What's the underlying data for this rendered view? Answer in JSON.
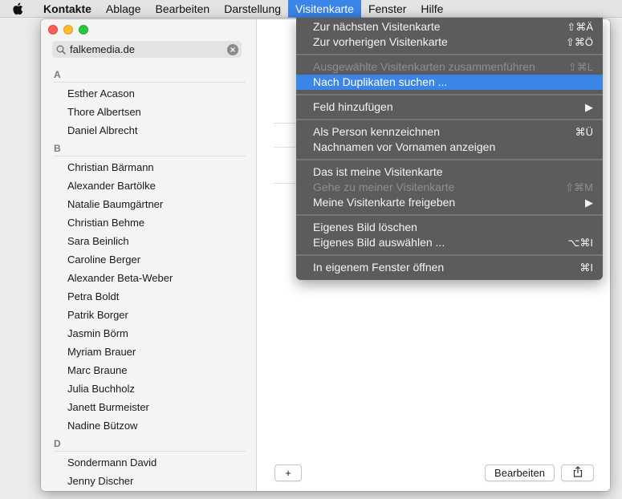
{
  "menubar": {
    "app_name": "Kontakte",
    "items": [
      "Ablage",
      "Bearbeiten",
      "Darstellung",
      "Visitenkarte",
      "Fenster",
      "Hilfe"
    ],
    "active": "Visitenkarte"
  },
  "search": {
    "value": "falkemedia.de"
  },
  "contacts": {
    "sections": [
      {
        "letter": "A",
        "names": [
          "Esther Acason",
          "Thore Albertsen",
          "Daniel Albrecht"
        ]
      },
      {
        "letter": "B",
        "names": [
          "Christian Bärmann",
          "Alexander Bartölke",
          "Natalie Baumgärtner",
          "Christian Behme",
          "Sara Beinlich",
          "Caroline Berger",
          "Alexander Beta-Weber",
          "Petra Boldt",
          "Patrik Borger",
          "Jasmin Börm",
          "Myriam Brauer",
          "Marc Braune",
          "Julia Buchholz",
          "Janett Burmeister",
          "Nadine Bützow"
        ]
      },
      {
        "letter": "D",
        "names": [
          "Sondermann David",
          "Jenny Discher"
        ]
      }
    ]
  },
  "detail": {
    "add_label": "+",
    "edit_label": "Bearbeiten",
    "share_icon": "share-icon"
  },
  "dropdown": {
    "groups": [
      [
        {
          "label": "Zur nächsten Visitenkarte",
          "shortcut": "⇧⌘Ä",
          "disabled": false
        },
        {
          "label": "Zur vorherigen Visitenkarte",
          "shortcut": "⇧⌘Ö",
          "disabled": false
        }
      ],
      [
        {
          "label": "Ausgewählte Visitenkarten zusammenführen",
          "shortcut": "⇧⌘L",
          "disabled": true
        },
        {
          "label": "Nach Duplikaten suchen ...",
          "shortcut": "",
          "disabled": false,
          "selected": true
        }
      ],
      [
        {
          "label": "Feld hinzufügen",
          "shortcut": "▶",
          "disabled": false
        }
      ],
      [
        {
          "label": "Als Person kennzeichnen",
          "shortcut": "⌘Ü",
          "disabled": false
        },
        {
          "label": "Nachnamen vor Vornamen anzeigen",
          "shortcut": "",
          "disabled": false
        }
      ],
      [
        {
          "label": "Das ist meine Visitenkarte",
          "shortcut": "",
          "disabled": false
        },
        {
          "label": "Gehe zu meiner Visitenkarte",
          "shortcut": "⇧⌘M",
          "disabled": true
        },
        {
          "label": "Meine Visitenkarte freigeben",
          "shortcut": "▶",
          "disabled": false
        }
      ],
      [
        {
          "label": "Eigenes Bild löschen",
          "shortcut": "",
          "disabled": false
        },
        {
          "label": "Eigenes Bild auswählen ...",
          "shortcut": "⌥⌘I",
          "disabled": false
        }
      ],
      [
        {
          "label": "In eigenem Fenster öffnen",
          "shortcut": "⌘I",
          "disabled": false
        }
      ]
    ]
  },
  "colors": {
    "menu_highlight": "#3b84e8",
    "dropdown_bg": "#5c5c5e"
  }
}
